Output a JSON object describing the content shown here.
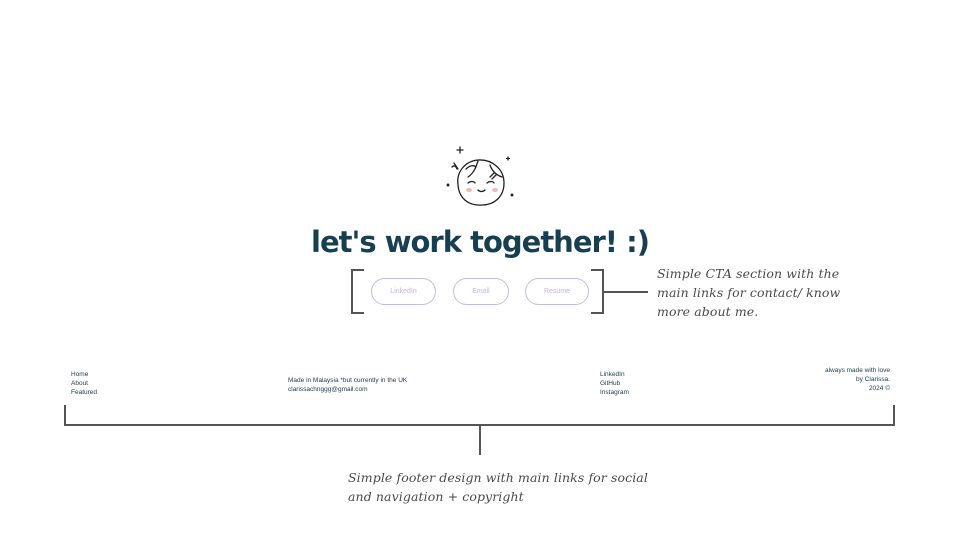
{
  "cta": {
    "title": "let's work together! :)",
    "buttons": [
      {
        "label": "LinkedIn"
      },
      {
        "label": "Email"
      },
      {
        "label": "Resume"
      }
    ]
  },
  "annotations": {
    "cta_note": "Simple CTA section with the main links for contact/ know more about me.",
    "footer_note": "Simple footer design with main links for social and navigation + copyright"
  },
  "footer": {
    "nav": [
      "Home",
      "About",
      "Featured"
    ],
    "location": "Made in Malaysia *but currently in the UK",
    "email": "clarissachnggg@gmail.com",
    "social": [
      "LinkedIn",
      "GitHub",
      "Instagram"
    ],
    "copyright_lines": [
      "always made with love",
      "by Clarissa.",
      "2024 ©"
    ]
  },
  "colors": {
    "heading": "#173f52",
    "button_border": "#c9b8ec",
    "bracket": "#555555"
  }
}
